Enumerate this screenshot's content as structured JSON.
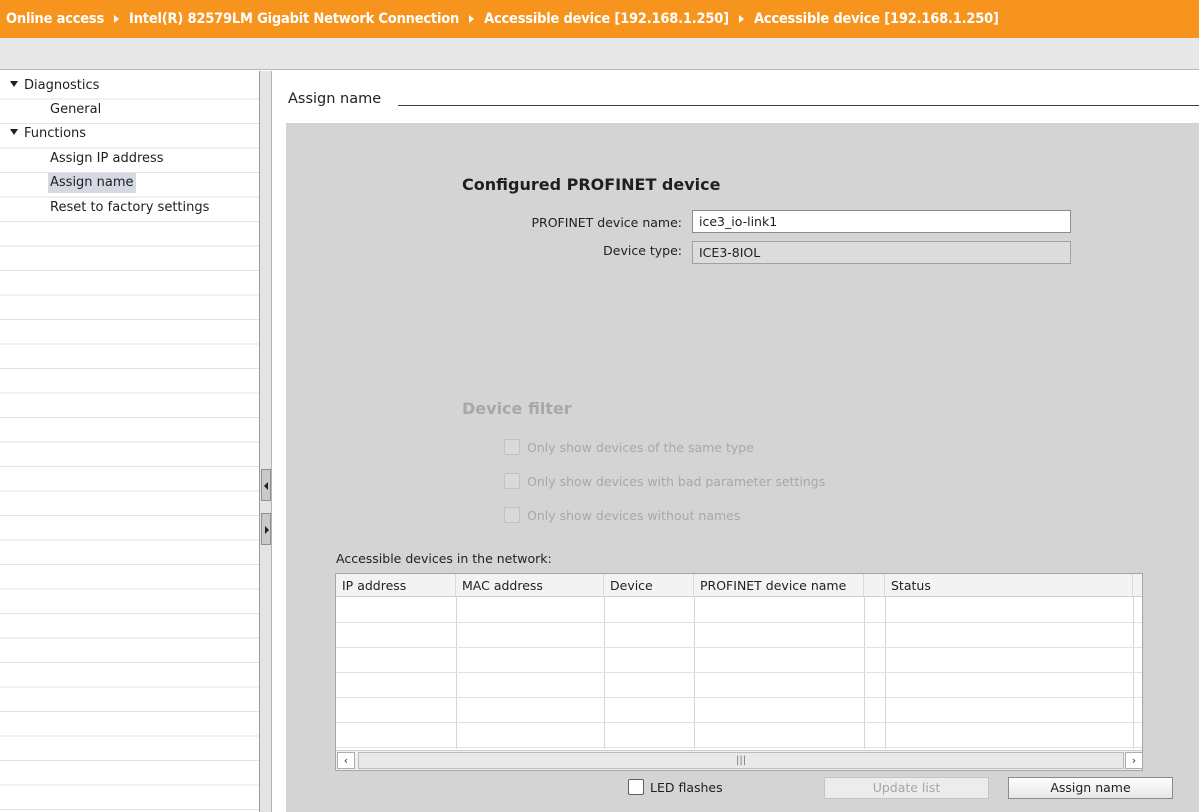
{
  "breadcrumb": [
    "Online access",
    "Intel(R) 82579LM Gigabit Network Connection",
    "Accessible device [192.168.1.250]",
    "Accessible device [192.168.1.250]"
  ],
  "navigation": {
    "diagnostics": "Diagnostics",
    "general": "General",
    "functions": "Functions",
    "assign_ip": "Assign IP address",
    "assign_name": "Assign name",
    "reset": "Reset to factory settings"
  },
  "page": {
    "section_title": "Assign name",
    "configured_heading": "Configured PROFINET device",
    "profinet_name_label": "PROFINET device name:",
    "profinet_name_value": "ice3_io-link1",
    "device_type_label": "Device type:",
    "device_type_value": "ICE3-8IOL",
    "filter_heading": "Device filter",
    "filter_same_type": "Only show devices of the same type",
    "filter_bad_params": "Only show devices with bad parameter settings",
    "filter_no_names": "Only show devices without names",
    "list_caption": "Accessible devices in the network:"
  },
  "table": {
    "columns": [
      "IP address",
      "MAC address",
      "Device",
      "PROFINET device name",
      "Status"
    ],
    "rows": []
  },
  "footer": {
    "led_flashes": "LED flashes",
    "update_list": "Update list",
    "assign_name": "Assign name"
  },
  "colors": {
    "breadcrumb_bg": "#f7941e",
    "panel_bg": "#d4d4d4",
    "selected_nav": "#d4d9e3"
  }
}
